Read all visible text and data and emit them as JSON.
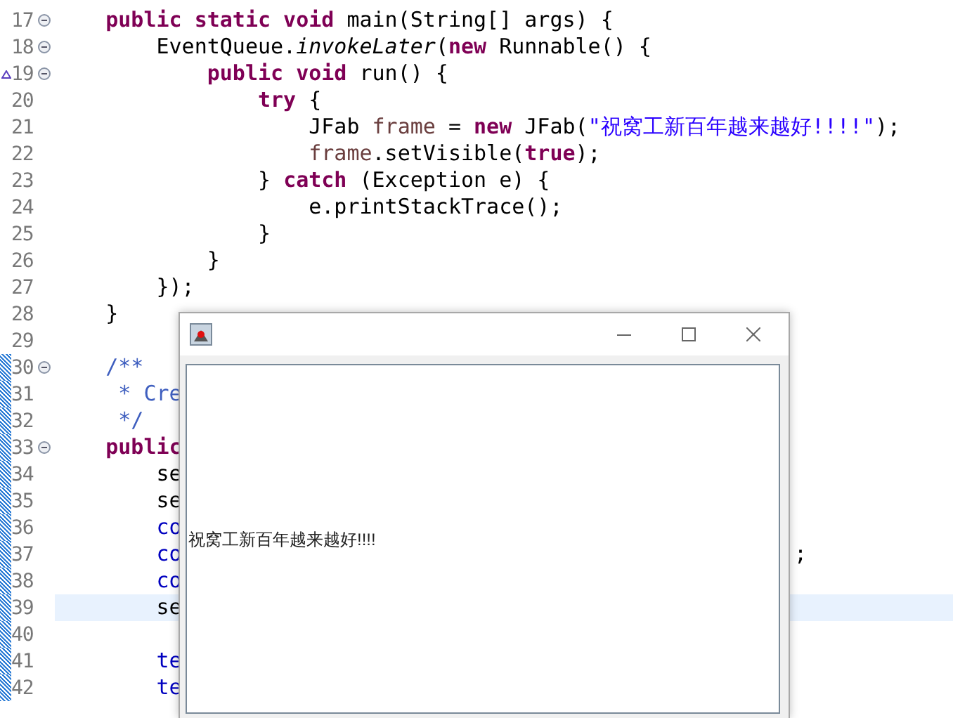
{
  "editor": {
    "lines": [
      {
        "number": "17",
        "fold": true,
        "override": false,
        "changed": false,
        "highlighted": false,
        "segments": [
          {
            "kind": "keyword",
            "text": "    public static void"
          },
          {
            "kind": "plain",
            "text": " main(String[] args) {"
          }
        ]
      },
      {
        "number": "18",
        "fold": true,
        "override": false,
        "changed": false,
        "highlighted": false,
        "segments": [
          {
            "kind": "plain",
            "text": "        EventQueue."
          },
          {
            "kind": "italic",
            "text": "invokeLater"
          },
          {
            "kind": "plain",
            "text": "("
          },
          {
            "kind": "keyword",
            "text": "new"
          },
          {
            "kind": "plain",
            "text": " Runnable() {"
          }
        ]
      },
      {
        "number": "19",
        "fold": true,
        "override": true,
        "changed": false,
        "highlighted": false,
        "segments": [
          {
            "kind": "keyword",
            "text": "            public void"
          },
          {
            "kind": "plain",
            "text": " run() {"
          }
        ]
      },
      {
        "number": "20",
        "fold": false,
        "override": false,
        "changed": false,
        "highlighted": false,
        "segments": [
          {
            "kind": "keyword",
            "text": "                try"
          },
          {
            "kind": "plain",
            "text": " {"
          }
        ]
      },
      {
        "number": "21",
        "fold": false,
        "override": false,
        "changed": false,
        "highlighted": false,
        "segments": [
          {
            "kind": "plain",
            "text": "                    JFab "
          },
          {
            "kind": "local",
            "text": "frame"
          },
          {
            "kind": "plain",
            "text": " = "
          },
          {
            "kind": "keyword",
            "text": "new"
          },
          {
            "kind": "plain",
            "text": " JFab("
          },
          {
            "kind": "string",
            "text": "\"祝窝工新百年越来越好!!!!\""
          },
          {
            "kind": "plain",
            "text": ");"
          }
        ]
      },
      {
        "number": "22",
        "fold": false,
        "override": false,
        "changed": false,
        "highlighted": false,
        "segments": [
          {
            "kind": "local",
            "text": "                    frame"
          },
          {
            "kind": "plain",
            "text": ".setVisible("
          },
          {
            "kind": "keyword",
            "text": "true"
          },
          {
            "kind": "plain",
            "text": ");"
          }
        ]
      },
      {
        "number": "23",
        "fold": false,
        "override": false,
        "changed": false,
        "highlighted": false,
        "segments": [
          {
            "kind": "plain",
            "text": "                } "
          },
          {
            "kind": "keyword",
            "text": "catch"
          },
          {
            "kind": "plain",
            "text": " (Exception e) {"
          }
        ]
      },
      {
        "number": "24",
        "fold": false,
        "override": false,
        "changed": false,
        "highlighted": false,
        "segments": [
          {
            "kind": "plain",
            "text": "                    e.printStackTrace();"
          }
        ]
      },
      {
        "number": "25",
        "fold": false,
        "override": false,
        "changed": false,
        "highlighted": false,
        "segments": [
          {
            "kind": "plain",
            "text": "                }"
          }
        ]
      },
      {
        "number": "26",
        "fold": false,
        "override": false,
        "changed": false,
        "highlighted": false,
        "segments": [
          {
            "kind": "plain",
            "text": "            }"
          }
        ]
      },
      {
        "number": "27",
        "fold": false,
        "override": false,
        "changed": false,
        "highlighted": false,
        "segments": [
          {
            "kind": "plain",
            "text": "        });"
          }
        ]
      },
      {
        "number": "28",
        "fold": false,
        "override": false,
        "changed": false,
        "highlighted": false,
        "segments": [
          {
            "kind": "plain",
            "text": "    }"
          }
        ]
      },
      {
        "number": "29",
        "fold": false,
        "override": false,
        "changed": false,
        "highlighted": false
      },
      {
        "number": "30",
        "fold": true,
        "override": false,
        "changed": true,
        "highlighted": false,
        "segments": [
          {
            "kind": "comment",
            "text": "    /**"
          }
        ]
      },
      {
        "number": "31",
        "fold": false,
        "override": false,
        "changed": true,
        "highlighted": false,
        "segments": [
          {
            "kind": "comment",
            "text": "     * Cre"
          }
        ]
      },
      {
        "number": "32",
        "fold": false,
        "override": false,
        "changed": true,
        "highlighted": false,
        "segments": [
          {
            "kind": "comment",
            "text": "     */"
          }
        ]
      },
      {
        "number": "33",
        "fold": true,
        "override": false,
        "changed": true,
        "highlighted": false,
        "segments": [
          {
            "kind": "keyword",
            "text": "    public"
          }
        ]
      },
      {
        "number": "34",
        "fold": false,
        "override": false,
        "changed": true,
        "highlighted": false,
        "segments": [
          {
            "kind": "plain",
            "text": "        se"
          }
        ]
      },
      {
        "number": "35",
        "fold": false,
        "override": false,
        "changed": true,
        "highlighted": false,
        "segments": [
          {
            "kind": "plain",
            "text": "        se"
          }
        ]
      },
      {
        "number": "36",
        "fold": false,
        "override": false,
        "changed": true,
        "highlighted": false,
        "segments": [
          {
            "kind": "field",
            "text": "        co"
          }
        ]
      },
      {
        "number": "37",
        "fold": false,
        "override": false,
        "changed": true,
        "highlighted": false,
        "segments": [
          {
            "kind": "field",
            "text": "        co"
          },
          {
            "kind": "tail",
            "text": ";"
          }
        ]
      },
      {
        "number": "38",
        "fold": false,
        "override": false,
        "changed": true,
        "highlighted": false,
        "segments": [
          {
            "kind": "field",
            "text": "        co"
          }
        ]
      },
      {
        "number": "39",
        "fold": false,
        "override": false,
        "changed": true,
        "highlighted": true,
        "segments": [
          {
            "kind": "plain",
            "text": "        se"
          }
        ]
      },
      {
        "number": "40",
        "fold": false,
        "override": false,
        "changed": true,
        "highlighted": false
      },
      {
        "number": "41",
        "fold": false,
        "override": false,
        "changed": true,
        "highlighted": false,
        "segments": [
          {
            "kind": "field",
            "text": "        te"
          }
        ]
      },
      {
        "number": "42",
        "fold": false,
        "override": false,
        "changed": true,
        "highlighted": false,
        "segments": [
          {
            "kind": "field",
            "text": "        te"
          }
        ]
      }
    ]
  },
  "java_window": {
    "label": "祝窝工新百年越来越好!!!!"
  }
}
